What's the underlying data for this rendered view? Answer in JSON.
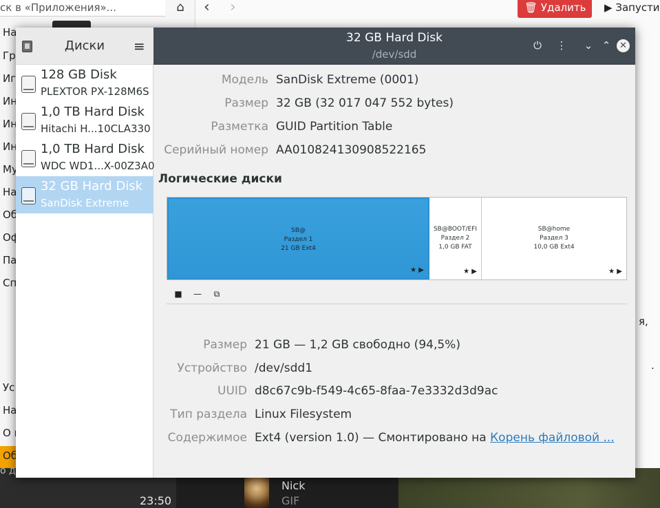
{
  "background_app": {
    "search_placeholder": "ск в «Приложения»...",
    "delete_label": "Удалить",
    "launch_label": "Запусти",
    "categories": [
      "На",
      "Гра",
      "Иг",
      "Ин",
      "Ин",
      "Ин",
      "Му",
      "На",
      "Об",
      "Оф",
      "Па",
      "Сп"
    ],
    "bottom_items": [
      "Ус",
      "На",
      "О п",
      "Об"
    ],
    "right_fragment_1": "я,",
    "right_fragment_2": "."
  },
  "taskbar": {
    "clock": "23:50",
    "left_text": "о ди",
    "chat_name": "Nick",
    "chat_subtitle": "GIF"
  },
  "disks": {
    "sidebar_title": "Диски",
    "window_title": "32 GB Hard Disk",
    "window_subtitle": "/dev/sdd",
    "devices": [
      {
        "name": "128 GB Disk",
        "model": "PLEXTOR PX-128M6S",
        "selected": false
      },
      {
        "name": "1,0 TB Hard Disk",
        "model": "Hitachi H...10CLA330",
        "selected": false
      },
      {
        "name": "1,0 TB Hard Disk",
        "model": "WDC WD1...X-00Z3A0",
        "selected": false
      },
      {
        "name": "32 GB Hard Disk",
        "model": "SanDisk Extreme",
        "selected": true
      }
    ],
    "drive_props": [
      {
        "label": "Модель",
        "value": "SanDisk Extreme (0001)"
      },
      {
        "label": "Размер",
        "value": "32 GB (32 017 047 552 bytes)"
      },
      {
        "label": "Разметка",
        "value": "GUID Partition Table"
      },
      {
        "label": "Серийный номер",
        "value": "AA010824130908522165"
      }
    ],
    "volumes_title": "Логические диски",
    "partitions": [
      {
        "name": "SB@",
        "part": "Раздел 1",
        "size": "21 GB Ext4",
        "selected": true
      },
      {
        "name": "SB@BOOT/EFI",
        "part": "Раздел 2",
        "size": "1,0 GB FAT",
        "selected": false
      },
      {
        "name": "SB@home",
        "part": "Раздел 3",
        "size": "10,0 GB Ext4",
        "selected": false
      }
    ],
    "volume_props": [
      {
        "label": "Размер",
        "value": "21 GB — 1,2 GB свободно (94,5%)"
      },
      {
        "label": "Устройство",
        "value": "/dev/sdd1"
      },
      {
        "label": "UUID",
        "value": "d8c67c9b-f549-4c65-8faa-7e3332d3d9ac"
      },
      {
        "label": "Тип раздела",
        "value": "Linux Filesystem"
      },
      {
        "label": "Содержимое",
        "value": "Ext4 (version 1.0) — Смонтировано на ",
        "link": "Корень файловой ..."
      }
    ]
  }
}
